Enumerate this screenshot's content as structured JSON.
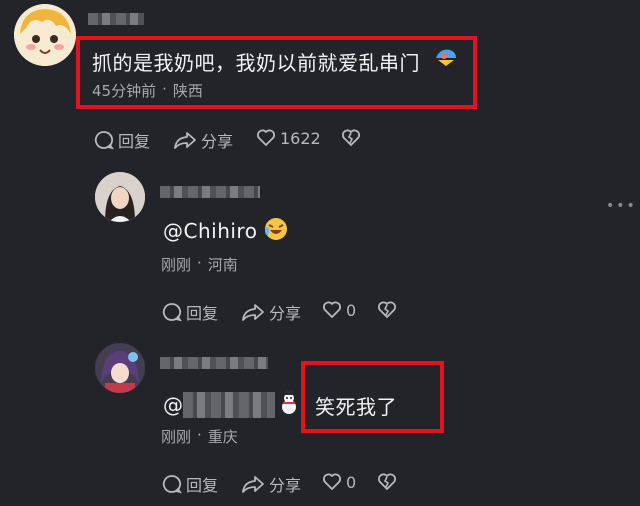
{
  "comments": [
    {
      "text": "抓的是我奶吧，我奶以前就爱乱串门",
      "time": "45分钟前",
      "location": "陕西",
      "reply_label": "回复",
      "share_label": "分享",
      "likes": "1622"
    },
    {
      "mention": "@Chihiro",
      "time": "刚刚",
      "location": "河南",
      "reply_label": "回复",
      "share_label": "分享",
      "likes": "0"
    },
    {
      "mention": "@",
      "text": "笑死我了",
      "time": "刚刚",
      "location": "重庆",
      "reply_label": "回复",
      "share_label": "分享",
      "likes": "0"
    }
  ],
  "separator": "·",
  "colors": {
    "highlight": "#e0141f",
    "background": "#232429"
  }
}
